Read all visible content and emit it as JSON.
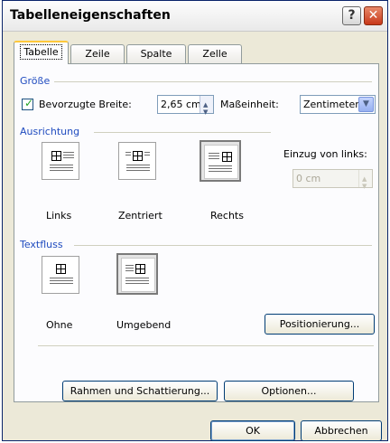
{
  "window": {
    "title": "Tabelleneigenschaften"
  },
  "tabs": [
    {
      "label": "Tabelle"
    },
    {
      "label": "Zeile"
    },
    {
      "label": "Spalte"
    },
    {
      "label": "Zelle"
    }
  ],
  "size": {
    "section_label": "Größe",
    "preferred_width_label": "Bevorzugte Breite:",
    "preferred_width_checked": true,
    "preferred_width_value": "2,65 cm",
    "unit_label": "Maßeinheit:",
    "unit_value": "Zentimeter"
  },
  "alignment": {
    "section_label": "Ausrichtung",
    "options": [
      {
        "label": "Links",
        "selected": false
      },
      {
        "label": "Zentriert",
        "selected": false
      },
      {
        "label": "Rechts",
        "selected": true
      }
    ],
    "indent_label": "Einzug von links:",
    "indent_value": "0 cm"
  },
  "text_wrapping": {
    "section_label": "Textfluss",
    "options": [
      {
        "label": "Ohne",
        "selected": false
      },
      {
        "label": "Umgebend",
        "selected": true
      }
    ],
    "positioning_label": "Positionierung..."
  },
  "buttons": {
    "borders_shading": "Rahmen und Schattierung...",
    "options": "Optionen...",
    "ok": "OK",
    "cancel": "Abbrechen"
  }
}
